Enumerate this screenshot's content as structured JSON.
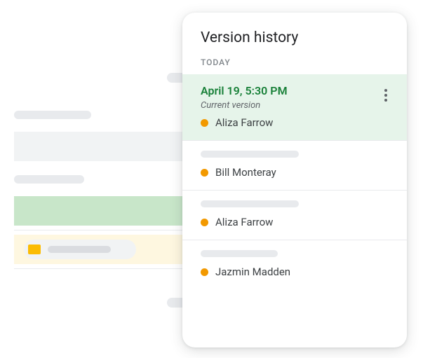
{
  "panel": {
    "title": "Version history",
    "section": "TODAY"
  },
  "colors": {
    "editor_dot": "#f29900"
  },
  "versions": [
    {
      "timestamp": "April 19, 5:30 PM",
      "subtitle": "Current version",
      "editor": "Aliza Farrow",
      "current": true
    },
    {
      "editor": "Bill Monteray"
    },
    {
      "editor": "Aliza Farrow"
    },
    {
      "editor": "Jazmin Madden"
    }
  ]
}
